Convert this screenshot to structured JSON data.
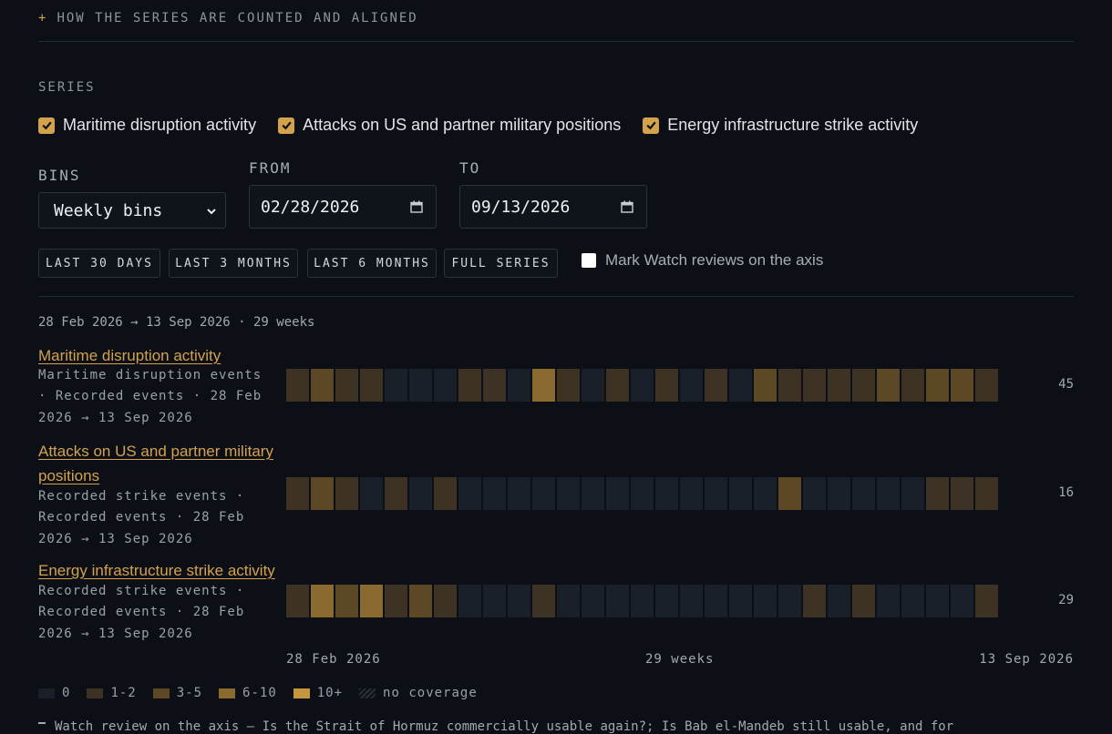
{
  "header": {
    "plus": "+",
    "toggle_label": "HOW THE SERIES ARE COUNTED AND ALIGNED"
  },
  "series_section": {
    "label": "SERIES",
    "options": [
      {
        "label": "Maritime disruption activity",
        "checked": true
      },
      {
        "label": "Attacks on US and partner military positions",
        "checked": true
      },
      {
        "label": "Energy infrastructure strike activity",
        "checked": true
      }
    ]
  },
  "controls": {
    "bins_label": "BINS",
    "bins_value": "Weekly bins",
    "from_label": "FROM",
    "from_value": "02/28/2026",
    "to_label": "TO",
    "to_value": "09/13/2026",
    "presets": [
      "LAST 30 DAYS",
      "LAST 3 MONTHS",
      "LAST 6 MONTHS",
      "FULL SERIES"
    ],
    "watch_label": "Mark Watch reviews on the axis",
    "watch_checked": false
  },
  "summary": {
    "range_text": "28 Feb 2026 → 13 Sep 2026 · 29 weeks"
  },
  "colors": {
    "accent": "#d4a24c",
    "bucket_0": "#1a2029",
    "bucket_1_2": "#3d3223",
    "bucket_3_5": "#5c4824",
    "bucket_6_10": "#8a6a2f",
    "bucket_10_plus": "#c6953f"
  },
  "chart_data": {
    "type": "heatmap",
    "x_start": "28 Feb 2026",
    "x_end": "13 Sep 2026",
    "x_middle_label": "29 weeks",
    "bins": 29,
    "buckets": [
      "0",
      "1-2",
      "3-5",
      "6-10",
      "10+",
      "no coverage"
    ],
    "series": [
      {
        "name": "Maritime disruption activity",
        "desc": "Maritime disruption events · Recorded events · 28 Feb 2026 → 13 Sep 2026",
        "total": "45",
        "levels": [
          1,
          2,
          1,
          1,
          0,
          0,
          0,
          1,
          1,
          0,
          3,
          1,
          0,
          1,
          0,
          1,
          0,
          1,
          0,
          2,
          1,
          1,
          1,
          1,
          2,
          1,
          2,
          2,
          1
        ]
      },
      {
        "name": "Attacks on US and partner military positions",
        "desc": "Recorded strike events · Recorded events · 28 Feb 2026 → 13 Sep 2026",
        "total": "16",
        "levels": [
          1,
          2,
          1,
          0,
          1,
          0,
          1,
          0,
          0,
          0,
          0,
          0,
          0,
          0,
          0,
          0,
          0,
          0,
          0,
          0,
          2,
          0,
          0,
          0,
          0,
          0,
          1,
          1,
          1
        ]
      },
      {
        "name": "Energy infrastructure strike activity",
        "desc": "Recorded strike events · Recorded events · 28 Feb 2026 → 13 Sep 2026",
        "total": "29",
        "levels": [
          1,
          3,
          2,
          3,
          1,
          2,
          1,
          0,
          0,
          0,
          1,
          0,
          0,
          0,
          0,
          0,
          0,
          0,
          0,
          0,
          0,
          1,
          0,
          1,
          0,
          0,
          0,
          0,
          1
        ]
      }
    ]
  },
  "footnote": {
    "text": "Watch review on the axis — Is the Strait of Hormuz commercially usable again?; Is Bab el-Mandeb still usable, and for"
  }
}
